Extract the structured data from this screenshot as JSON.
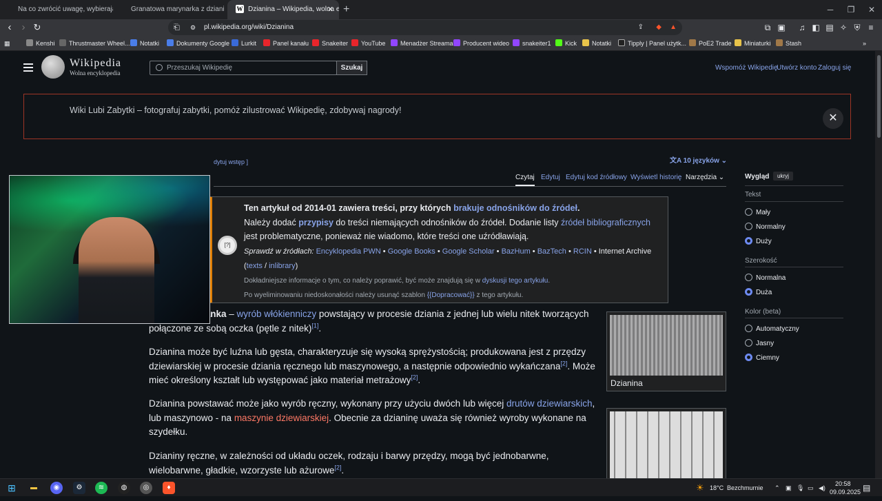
{
  "browser": {
    "tabs": [
      {
        "label": "Na co zwrócić uwagę, wybierając gar"
      },
      {
        "label": "Granatowa marynarka z dzianiny 01 |"
      },
      {
        "label": "Dzianina – Wikipedia, wolna ency"
      }
    ],
    "url": "pl.wikipedia.org/wiki/Dzianina",
    "bookmarks": [
      "Kenshi",
      "Thrustmaster Wheel...",
      "Notatki",
      "Dokumenty Google",
      "Lurkit",
      "Panel kanału",
      "Snakeiter",
      "YouTube",
      "Menadżer Streama",
      "Producent wideo",
      "snakeiter1",
      "Kick",
      "Notatki",
      "Tipply | Panel użytk...",
      "PoE2 Trade",
      "Miniaturki",
      "Stash"
    ]
  },
  "wiki": {
    "brand": "Wikipedia",
    "tagline": "Wolna encyklopedia",
    "search_placeholder": "Przeszukaj Wikipedię",
    "search_button": "Szukaj",
    "header_links": [
      "Wspomóż Wikipedię",
      "Utwórz konto",
      "Zaloguj się"
    ],
    "banner": "Wiki Lubi Zabytki – fotografuj zabytki, pomóż zilustrować Wikipedię, zdobywaj nagrody!",
    "edit_intro": "dytuj wstęp ]",
    "languages": "10 języków",
    "tabs": [
      "Czytaj",
      "Edytuj",
      "Edytuj kod źródłowy",
      "Wyświetl historię",
      "Narzędzia"
    ],
    "ambox": {
      "icon": "[?]",
      "line1a": "Ten artykuł od 2014-01 zawiera treści, przy których ",
      "line1b": "brakuje odnośników do źródeł",
      "line2a": "Należy dodać ",
      "line2b": "przypisy",
      "line2c": " do treści niemających odnośników do źródeł. Dodanie listy ",
      "line2d": "źródeł bibliograficznych",
      "line2e": " jest problematyczne, ponieważ nie wiadomo, które treści one uźródławiają.",
      "sources_label": "Sprawdź w źródłach:",
      "sources": [
        "Encyklopedia PWN",
        "Google Books",
        "Google Scholar",
        "BazHum",
        "BazTech",
        "RCIN",
        "Internet Archive"
      ],
      "texts": "texts",
      "inlibrary": "inlibrary",
      "note1a": "Dokładniejsze informacje o tym, co należy poprawić, być może znajdują się w ",
      "note1b": "dyskusji tego artykułu",
      "note2a": "Po wyeliminowaniu niedoskonałości należy usunąć szablon ",
      "note2b": "{{Dopracować}}",
      "note2c": " z tego artykułu."
    },
    "p1": {
      "bold": "Dzianina, dzianka",
      "dash": " – ",
      "link": "wyrób włókienniczy",
      "text": " powstający w procesie dziania z jednej lub wielu nitek tworzących połączone ze sobą oczka (pętle z nitek)",
      "ref": "[1]"
    },
    "p2": {
      "a": "Dzianina może być luźna lub gęsta, charakteryzuje się wysoką sprężystością; produkowana jest z przędzy dziewiarskiej w procesie dziania ręcznego lub maszynowego, a następnie odpowiednio wykańczana",
      "ref1": "[2]",
      "b": ". Może mieć określony kształt lub występować jako materiał metrażowy",
      "ref2": "[2]"
    },
    "p3": {
      "a": "Dzianina powstawać może jako wyrób ręczny, wykonany przy użyciu dwóch lub więcej ",
      "link1": "drutów dziewiarskich",
      "b": ", lub maszynowo - na ",
      "link2": "maszynie dziewiarskiej",
      "c": ". Obecnie za dzianinę uważa się również wyroby wykonane na szydełku."
    },
    "p4": {
      "a": "Dzianiny ręczne, w zależności od układu oczek, rodzaju i barwy przędzy, mogą być jednobarwne, wielobarwne, gładkie, wzorzyste lub ażurowe",
      "ref": "[2]"
    },
    "caption": "Dzianina",
    "appearance": {
      "title": "Wygląd",
      "hide": "ukryj",
      "text_label": "Tekst",
      "text_options": [
        "Mały",
        "Normalny",
        "Duży"
      ],
      "width_label": "Szerokość",
      "width_options": [
        "Normalna",
        "Duża"
      ],
      "color_label": "Kolor (beta)",
      "color_options": [
        "Automatyczny",
        "Jasny",
        "Ciemny"
      ]
    }
  },
  "taskbar": {
    "weather": "18°C",
    "weather_text": "Bezchmurnie",
    "time": "20:58",
    "date": "09.09.2025"
  }
}
